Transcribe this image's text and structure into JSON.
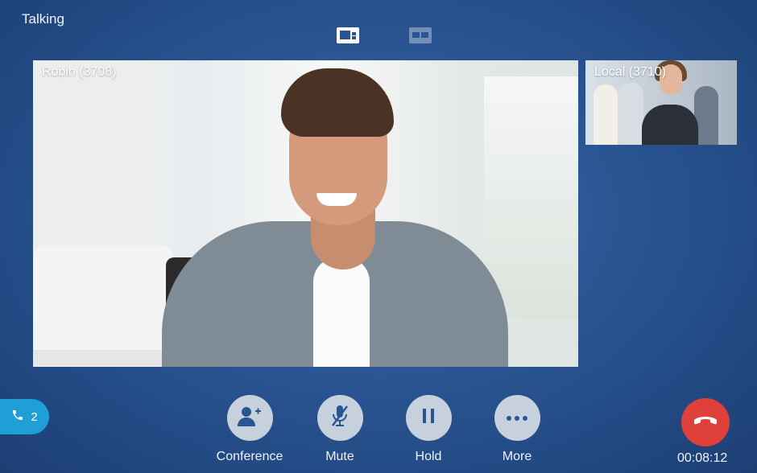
{
  "status": {
    "title": "Talking"
  },
  "layout_toggles": [
    {
      "name": "picture-in-picture",
      "selected": true
    },
    {
      "name": "equal",
      "selected": false
    }
  ],
  "remote": {
    "label": "Robin (3708)"
  },
  "local": {
    "label": "Local (3710)"
  },
  "call_badge": {
    "icon": "phone-icon",
    "count": "2"
  },
  "actions": [
    {
      "label": "Conference",
      "icon": "add-person-icon"
    },
    {
      "label": "Mute",
      "icon": "mic-muted-icon"
    },
    {
      "label": "Hold",
      "icon": "pause-icon"
    },
    {
      "label": "More",
      "icon": "more-dots-icon"
    }
  ],
  "end_call": {
    "icon": "hangup-icon",
    "color": "#e0403a"
  },
  "timer": "00:08:12",
  "colors": {
    "accent": "#1f9fd6",
    "button": "#c7d1de",
    "icon": "#2a5593"
  }
}
